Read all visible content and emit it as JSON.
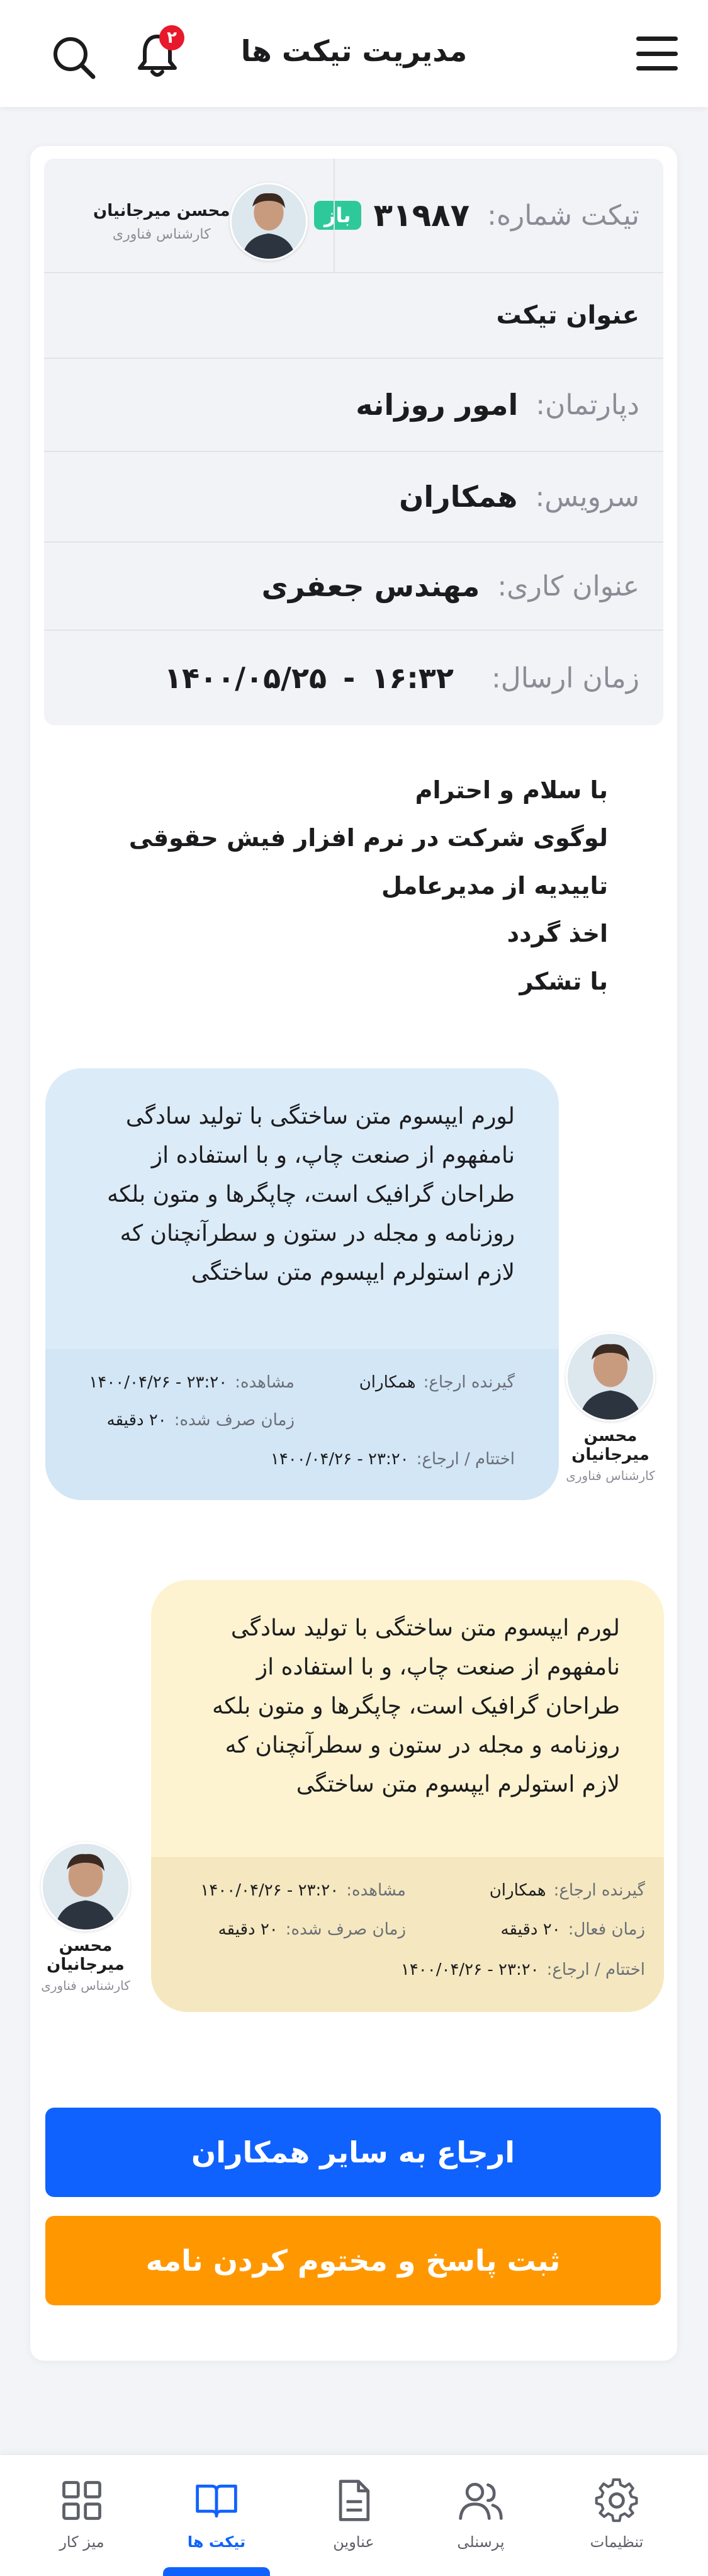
{
  "header": {
    "title": "مدیریت تیکت ها",
    "notification_count": "۲"
  },
  "ticket": {
    "number_label": "تیکت شماره:",
    "number": "۳۱۹۸۷",
    "status": "باز",
    "assignee_name": "محسن میرجانیان",
    "assignee_role": "کارشناس فناوری",
    "subject": "عنوان تیکت",
    "department_label": "دپارتمان:",
    "department": "امور روزانه",
    "service_label": "سرویس:",
    "service": "همکاران",
    "job_title_label": "عنوان کاری:",
    "job_title": "مهندس جعفری",
    "sent_label": "زمان ارسال:",
    "sent_time": "۱۶:۳۲",
    "sent_sep": "-",
    "sent_date": "۱۴۰۰/۰۵/۲۵"
  },
  "message": {
    "line1": "با سلام و احترام",
    "line2": "لوگوی شرکت در نرم افزار فیش حقوقی تاییدیه از مدیرعامل",
    "line3": "اخذ گردد",
    "line4": "با تشکر"
  },
  "replies": [
    {
      "text": "لورم ایپسوم متن ساختگی با تولید سادگی نامفهوم از صنعت چاپ، و با استفاده از طراحان گرافیک است، چاپگرها و متون بلکه روزنامه و مجله در ستون و سطرآنچنان که لازم استولرم ایپسوم متن ساختگی",
      "recipient_label": "گیرنده ارجاع:",
      "recipient": "همکاران",
      "seen_label": "مشاهده:",
      "seen": "۲۳:۲۰ - ۱۴۰۰/۰۴/۲۶",
      "spent_label": "زمان صرف شده:",
      "spent": "۲۰ دقیقه",
      "end_label": "اختتام / ارجاع:",
      "end": "۲۳:۲۰ - ۱۴۰۰/۰۴/۲۶",
      "sender_name": "محسن میرجانیان",
      "sender_role": "کارشناس فناوری"
    },
    {
      "text": "لورم ایپسوم متن ساختگی با تولید سادگی نامفهوم از صنعت چاپ، و با استفاده از طراحان گرافیک است، چاپگرها و متون بلکه روزنامه و مجله در ستون و سطرآنچنان که لازم استولرم ایپسوم متن ساختگی",
      "recipient_label": "گیرنده ارجاع:",
      "recipient": "همکاران",
      "seen_label": "مشاهده:",
      "seen": "۲۳:۲۰ - ۱۴۰۰/۰۴/۲۶",
      "active_label": "زمان فعال:",
      "active": "۲۰ دقیقه",
      "spent_label": "زمان صرف شده:",
      "spent": "۲۰ دقیقه",
      "end_label": "اختتام / ارجاع:",
      "end": "۲۳:۲۰ - ۱۴۰۰/۰۴/۲۶",
      "sender_name": "محسن میرجانیان",
      "sender_role": "کارشناس فناوری"
    }
  ],
  "actions": {
    "refer": "ارجاع به سایر همکاران",
    "close": "ثبت پاسخ و مختوم کردن نامه"
  },
  "nav": {
    "desk": "میز کار",
    "tickets": "تیکت ها",
    "titles": "عناوین",
    "staff": "پرسنلی",
    "settings": "تنظیمات"
  },
  "colors": {
    "primary": "#0f62fe",
    "status_open": "#2ec99a",
    "orange": "#ff9800",
    "badge": "#e8192c"
  }
}
